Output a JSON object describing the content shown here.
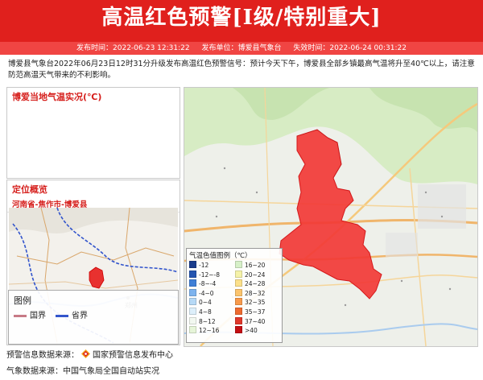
{
  "header": {
    "title": "高温红色预警[I级/特别重大]",
    "published": "发布时间：2022-06-23 12:31:22",
    "issuer": "发布单位：博爱县气象台",
    "expires": "失效时间：2022-06-24 00:31:22"
  },
  "description": "博爱县气象台2022年06月23日12时31分升级发布高温红色预警信号：预计今天下午，博爱县全部乡镇最高气温将升至40℃以上，请注意防范高温天气带来的不利影响。",
  "temp_panel": {
    "title": "博爱当地气温实况(℃)"
  },
  "location_panel": {
    "title": "定位概览",
    "path": "河南省-焦作市-博爱县",
    "legend_title": "图例",
    "legend_items": [
      {
        "label": "国界",
        "color": "#c77a86"
      },
      {
        "label": "省界",
        "color": "#3355cc"
      }
    ]
  },
  "color_legend": {
    "title": "气温色值图例（℃）",
    "items": [
      {
        "label": "-12",
        "color": "#1a3c8c"
      },
      {
        "label": "16~20",
        "color": "#d6f0c8"
      },
      {
        "label": "-12~-8",
        "color": "#2354b0"
      },
      {
        "label": "20~24",
        "color": "#f5f2a8"
      },
      {
        "label": "-8~-4",
        "color": "#3f7fd6"
      },
      {
        "label": "24~28",
        "color": "#fce08a"
      },
      {
        "label": "-4~0",
        "color": "#7db3ee"
      },
      {
        "label": "28~32",
        "color": "#fbc46d"
      },
      {
        "label": "0~4",
        "color": "#b6d9f6"
      },
      {
        "label": "32~35",
        "color": "#f89a4a"
      },
      {
        "label": "4~8",
        "color": "#ddeffa"
      },
      {
        "label": "35~37",
        "color": "#ee6a2e"
      },
      {
        "label": "8~12",
        "color": "#f2f8f0"
      },
      {
        "label": "37~40",
        "color": "#e0382a"
      },
      {
        "label": "12~16",
        "color": "#e6f5d8"
      },
      {
        "label": ">40",
        "color": "#c40e12"
      }
    ]
  },
  "sources": {
    "warning": "预警信息数据来源：",
    "warning_org": "国家预警信息发布中心",
    "weather": "气象数据来源：中国气象局全国自动站实况"
  },
  "map_labels": {
    "minimap_city": "郑州"
  }
}
